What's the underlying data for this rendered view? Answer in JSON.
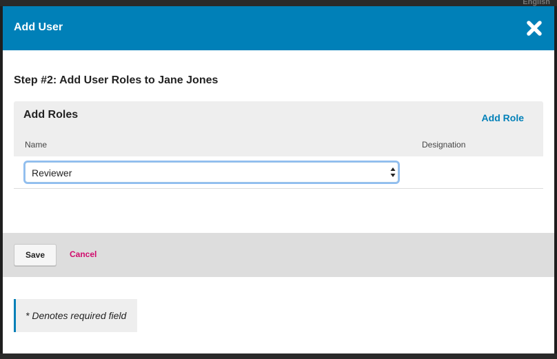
{
  "background": {
    "language_label": "English"
  },
  "modal": {
    "title": "Add User",
    "close_icon": "close-icon",
    "step_title": "Step #2: Add User Roles to Jane Jones",
    "roles_panel": {
      "heading": "Add Roles",
      "add_role_label": "Add Role",
      "columns": [
        "Name",
        "Designation"
      ],
      "rows": [
        {
          "role": "Reviewer",
          "designation": ""
        }
      ]
    },
    "footer": {
      "save_label": "Save",
      "cancel_label": "Cancel"
    },
    "required_note": "* Denotes required field"
  },
  "colors": {
    "header": "#0080b8",
    "accent_link": "#0080b8",
    "cancel": "#d00a6c"
  }
}
